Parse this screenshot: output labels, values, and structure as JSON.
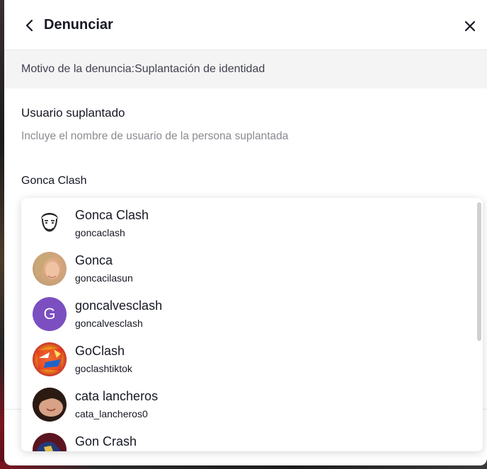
{
  "header": {
    "title": "Denunciar",
    "back_icon": "chevron-left-icon",
    "close_icon": "close-icon"
  },
  "reason": {
    "label": "Motivo de la denuncia:Suplantación de identidad"
  },
  "section": {
    "title": "Usuario suplantado",
    "description": "Incluye el nombre de usuario de la persona suplantada"
  },
  "search": {
    "value": "Gonca Clash"
  },
  "suggestions": [
    {
      "name": "Gonca Clash",
      "username": "goncaclash"
    },
    {
      "name": "Gonca",
      "username": "goncacilasun"
    },
    {
      "name": "goncalvesclash",
      "username": "goncalvesclash",
      "initial": "G",
      "avatar_color": "#7b4fc0"
    },
    {
      "name": "GoClash",
      "username": "goclashtiktok"
    },
    {
      "name": "cata lancheros",
      "username": "cata_lancheros0"
    },
    {
      "name": "Gon Crash",
      "username": ""
    }
  ]
}
